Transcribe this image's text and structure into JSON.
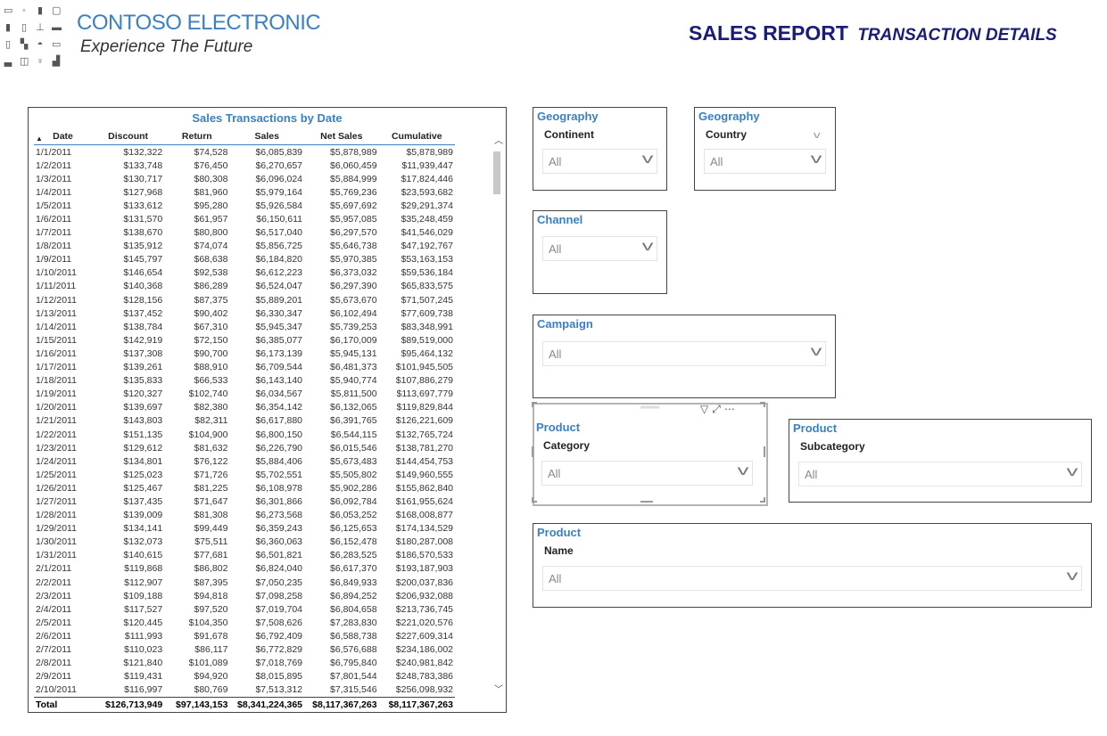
{
  "header": {
    "brand": "CONTOSO ELECTRONIC",
    "tagline": "Experience The Future",
    "title": "SALES REPORT",
    "subtitle": "TRANSACTION DETAILS"
  },
  "table": {
    "title": "Sales Transactions by Date",
    "columns": [
      "Date",
      "Discount",
      "Return",
      "Sales",
      "Net Sales",
      "Cumulative"
    ],
    "rows": [
      [
        "1/1/2011",
        "$132,322",
        "$74,528",
        "$6,085,839",
        "$5,878,989",
        "$5,878,989"
      ],
      [
        "1/2/2011",
        "$133,748",
        "$76,450",
        "$6,270,657",
        "$6,060,459",
        "$11,939,447"
      ],
      [
        "1/3/2011",
        "$130,717",
        "$80,308",
        "$6,096,024",
        "$5,884,999",
        "$17,824,446"
      ],
      [
        "1/4/2011",
        "$127,968",
        "$81,960",
        "$5,979,164",
        "$5,769,236",
        "$23,593,682"
      ],
      [
        "1/5/2011",
        "$133,612",
        "$95,280",
        "$5,926,584",
        "$5,697,692",
        "$29,291,374"
      ],
      [
        "1/6/2011",
        "$131,570",
        "$61,957",
        "$6,150,611",
        "$5,957,085",
        "$35,248,459"
      ],
      [
        "1/7/2011",
        "$138,670",
        "$80,800",
        "$6,517,040",
        "$6,297,570",
        "$41,546,029"
      ],
      [
        "1/8/2011",
        "$135,912",
        "$74,074",
        "$5,856,725",
        "$5,646,738",
        "$47,192,767"
      ],
      [
        "1/9/2011",
        "$145,797",
        "$68,638",
        "$6,184,820",
        "$5,970,385",
        "$53,163,153"
      ],
      [
        "1/10/2011",
        "$146,654",
        "$92,538",
        "$6,612,223",
        "$6,373,032",
        "$59,536,184"
      ],
      [
        "1/11/2011",
        "$140,368",
        "$86,289",
        "$6,524,047",
        "$6,297,390",
        "$65,833,575"
      ],
      [
        "1/12/2011",
        "$128,156",
        "$87,375",
        "$5,889,201",
        "$5,673,670",
        "$71,507,245"
      ],
      [
        "1/13/2011",
        "$137,452",
        "$90,402",
        "$6,330,347",
        "$6,102,494",
        "$77,609,738"
      ],
      [
        "1/14/2011",
        "$138,784",
        "$67,310",
        "$5,945,347",
        "$5,739,253",
        "$83,348,991"
      ],
      [
        "1/15/2011",
        "$142,919",
        "$72,150",
        "$6,385,077",
        "$6,170,009",
        "$89,519,000"
      ],
      [
        "1/16/2011",
        "$137,308",
        "$90,700",
        "$6,173,139",
        "$5,945,131",
        "$95,464,132"
      ],
      [
        "1/17/2011",
        "$139,261",
        "$88,910",
        "$6,709,544",
        "$6,481,373",
        "$101,945,505"
      ],
      [
        "1/18/2011",
        "$135,833",
        "$66,533",
        "$6,143,140",
        "$5,940,774",
        "$107,886,279"
      ],
      [
        "1/19/2011",
        "$120,327",
        "$102,740",
        "$6,034,567",
        "$5,811,500",
        "$113,697,779"
      ],
      [
        "1/20/2011",
        "$139,697",
        "$82,380",
        "$6,354,142",
        "$6,132,065",
        "$119,829,844"
      ],
      [
        "1/21/2011",
        "$143,803",
        "$82,311",
        "$6,617,880",
        "$6,391,765",
        "$126,221,609"
      ],
      [
        "1/22/2011",
        "$151,135",
        "$104,900",
        "$6,800,150",
        "$6,544,115",
        "$132,765,724"
      ],
      [
        "1/23/2011",
        "$129,612",
        "$81,632",
        "$6,226,790",
        "$6,015,546",
        "$138,781,270"
      ],
      [
        "1/24/2011",
        "$134,801",
        "$76,122",
        "$5,884,406",
        "$5,673,483",
        "$144,454,753"
      ],
      [
        "1/25/2011",
        "$125,023",
        "$71,726",
        "$5,702,551",
        "$5,505,802",
        "$149,960,555"
      ],
      [
        "1/26/2011",
        "$125,467",
        "$81,225",
        "$6,108,978",
        "$5,902,286",
        "$155,862,840"
      ],
      [
        "1/27/2011",
        "$137,435",
        "$71,647",
        "$6,301,866",
        "$6,092,784",
        "$161,955,624"
      ],
      [
        "1/28/2011",
        "$139,009",
        "$81,308",
        "$6,273,568",
        "$6,053,252",
        "$168,008,877"
      ],
      [
        "1/29/2011",
        "$134,141",
        "$99,449",
        "$6,359,243",
        "$6,125,653",
        "$174,134,529"
      ],
      [
        "1/30/2011",
        "$132,073",
        "$75,511",
        "$6,360,063",
        "$6,152,478",
        "$180,287,008"
      ],
      [
        "1/31/2011",
        "$140,615",
        "$77,681",
        "$6,501,821",
        "$6,283,525",
        "$186,570,533"
      ],
      [
        "2/1/2011",
        "$119,868",
        "$86,802",
        "$6,824,040",
        "$6,617,370",
        "$193,187,903"
      ],
      [
        "2/2/2011",
        "$112,907",
        "$87,395",
        "$7,050,235",
        "$6,849,933",
        "$200,037,836"
      ],
      [
        "2/3/2011",
        "$109,188",
        "$94,818",
        "$7,098,258",
        "$6,894,252",
        "$206,932,088"
      ],
      [
        "2/4/2011",
        "$117,527",
        "$97,520",
        "$7,019,704",
        "$6,804,658",
        "$213,736,745"
      ],
      [
        "2/5/2011",
        "$120,445",
        "$104,350",
        "$7,508,626",
        "$7,283,830",
        "$221,020,576"
      ],
      [
        "2/6/2011",
        "$111,993",
        "$91,678",
        "$6,792,409",
        "$6,588,738",
        "$227,609,314"
      ],
      [
        "2/7/2011",
        "$110,023",
        "$86,117",
        "$6,772,829",
        "$6,576,688",
        "$234,186,002"
      ],
      [
        "2/8/2011",
        "$121,840",
        "$101,089",
        "$7,018,769",
        "$6,795,840",
        "$240,981,842"
      ],
      [
        "2/9/2011",
        "$119,431",
        "$94,920",
        "$8,015,895",
        "$7,801,544",
        "$248,783,386"
      ],
      [
        "2/10/2011",
        "$116,997",
        "$80,769",
        "$7,513,312",
        "$7,315,546",
        "$256,098,932"
      ]
    ],
    "total": [
      "Total",
      "$126,713,949",
      "$97,143,153",
      "$8,341,224,365",
      "$8,117,367,263",
      "$8,117,367,263"
    ]
  },
  "slicers": {
    "continent": {
      "group": "Geography",
      "field": "Continent",
      "value": "All"
    },
    "country": {
      "group": "Geography",
      "field": "Country",
      "value": "All"
    },
    "channel": {
      "group": "Channel",
      "value": "All"
    },
    "campaign": {
      "group": "Campaign",
      "value": "All"
    },
    "category": {
      "group": "Product",
      "field": "Category",
      "value": "All"
    },
    "subcategory": {
      "group": "Product",
      "field": "Subcategory",
      "value": "All"
    },
    "name": {
      "group": "Product",
      "field": "Name",
      "value": "All"
    }
  },
  "icons": [
    "sort-ascending-icon",
    "scroll-up-icon",
    "scroll-down-icon",
    "chevron-down-icon",
    "filter-icon",
    "focus-mode-icon",
    "more-options-icon",
    "drag-grip-icon",
    "device-icons"
  ],
  "colors": {
    "accent": "#3b7fc4",
    "title": "#1b1b7a"
  }
}
